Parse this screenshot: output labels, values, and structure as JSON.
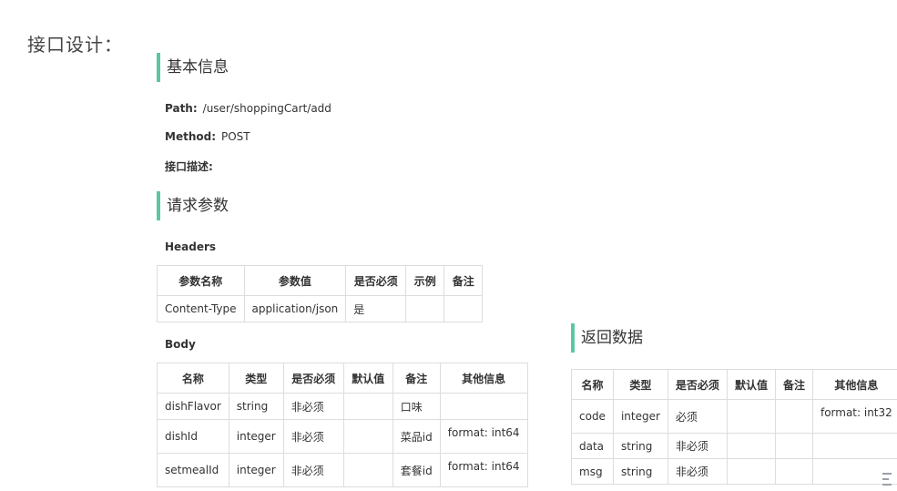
{
  "page_title": "接口设计：",
  "basic": {
    "heading": "基本信息",
    "path_label": "Path:",
    "path_value": "/user/shoppingCart/add",
    "method_label": "Method:",
    "method_value": "POST",
    "desc_label": "接口描述:"
  },
  "request": {
    "heading": "请求参数",
    "headers_label": "Headers",
    "headers_columns": [
      "参数名称",
      "参数值",
      "是否必须",
      "示例",
      "备注"
    ],
    "headers_rows": [
      [
        "Content-Type",
        "application/json",
        "是",
        "",
        ""
      ]
    ],
    "body_label": "Body",
    "body_columns": [
      "名称",
      "类型",
      "是否必须",
      "默认值",
      "备注",
      "其他信息"
    ],
    "body_rows": [
      [
        "dishFlavor",
        "string",
        "非必须",
        "",
        "口味",
        ""
      ],
      [
        "dishId",
        "integer",
        "非必须",
        "",
        "菜品id",
        "format: int64"
      ],
      [
        "setmealId",
        "integer",
        "非必须",
        "",
        "套餐id",
        "format: int64"
      ]
    ]
  },
  "response": {
    "heading": "返回数据",
    "columns": [
      "名称",
      "类型",
      "是否必须",
      "默认值",
      "备注",
      "其他信息"
    ],
    "rows": [
      [
        "code",
        "integer",
        "必须",
        "",
        "",
        "format: int32"
      ],
      [
        "data",
        "string",
        "非必须",
        "",
        "",
        ""
      ],
      [
        "msg",
        "string",
        "非必须",
        "",
        "",
        ""
      ]
    ]
  }
}
